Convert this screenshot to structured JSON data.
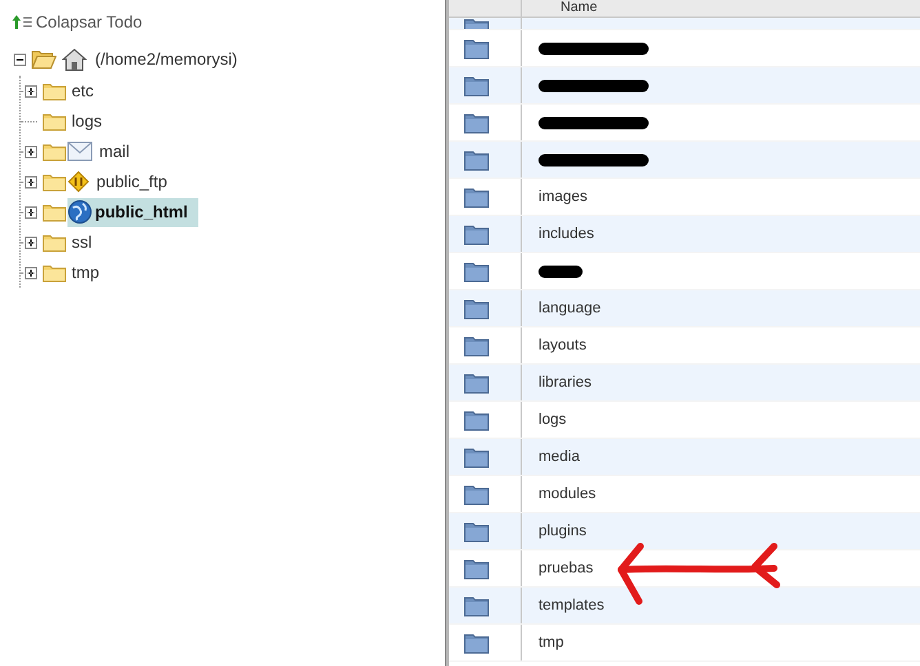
{
  "tree": {
    "collapse_all": "Colapsar Todo",
    "root": {
      "label": "(/home2/memorysi)",
      "expanded": true,
      "children": [
        {
          "label": "etc",
          "expandable": true,
          "kind": "plain",
          "selected": false
        },
        {
          "label": "logs",
          "expandable": false,
          "kind": "plain",
          "selected": false
        },
        {
          "label": "mail",
          "expandable": true,
          "kind": "mail",
          "selected": false
        },
        {
          "label": "public_ftp",
          "expandable": true,
          "kind": "ftp",
          "selected": false
        },
        {
          "label": "public_html",
          "expandable": true,
          "kind": "web",
          "selected": true
        },
        {
          "label": "ssl",
          "expandable": true,
          "kind": "plain",
          "selected": false
        },
        {
          "label": "tmp",
          "expandable": true,
          "kind": "plain",
          "selected": false
        }
      ]
    }
  },
  "file_list": {
    "columns": [
      "Name"
    ],
    "rows": [
      {
        "kind": "clipped"
      },
      {
        "kind": "redacted"
      },
      {
        "kind": "redacted"
      },
      {
        "kind": "redacted"
      },
      {
        "kind": "redacted"
      },
      {
        "kind": "folder",
        "name": "images"
      },
      {
        "kind": "folder",
        "name": "includes"
      },
      {
        "kind": "redacted"
      },
      {
        "kind": "folder",
        "name": "language"
      },
      {
        "kind": "folder",
        "name": "layouts"
      },
      {
        "kind": "folder",
        "name": "libraries"
      },
      {
        "kind": "folder",
        "name": "logs"
      },
      {
        "kind": "folder",
        "name": "media"
      },
      {
        "kind": "folder",
        "name": "modules"
      },
      {
        "kind": "folder",
        "name": "plugins"
      },
      {
        "kind": "folder",
        "name": "pruebas"
      },
      {
        "kind": "folder",
        "name": "templates"
      },
      {
        "kind": "folder",
        "name": "tmp"
      }
    ]
  }
}
